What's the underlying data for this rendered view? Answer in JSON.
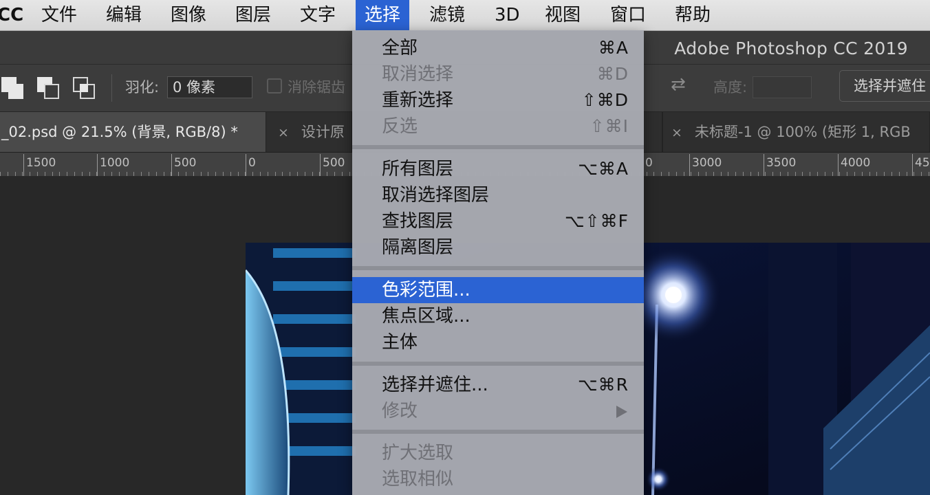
{
  "menubar": {
    "app": "CC",
    "items": [
      "文件",
      "编辑",
      "图像",
      "图层",
      "文字",
      "选择",
      "滤镜",
      "3D",
      "视图",
      "窗口",
      "帮助"
    ],
    "active": "选择"
  },
  "window": {
    "title": "Adobe Photoshop CC 2019"
  },
  "options": {
    "feather_label": "羽化:",
    "feather_value": "0 像素",
    "antialias_label": "消除锯齿",
    "height_label": "高度:",
    "refine_button": "选择并遮住"
  },
  "tabs": [
    {
      "label": "_02.psd @ 21.5% (背景, RGB/8) *",
      "active": true,
      "close": ""
    },
    {
      "label": "设计原",
      "active": false,
      "close": "×"
    },
    {
      "label": "未标题-1 @ 100% (矩形 1, RGB",
      "active": false,
      "close": "×"
    }
  ],
  "ruler": {
    "labels": [
      "1500",
      "1000",
      "500",
      "0",
      "500",
      "0",
      "3000",
      "3500",
      "4000",
      "45"
    ]
  },
  "select_menu": {
    "groups": [
      [
        {
          "label": "全部",
          "shortcut": "⌘A",
          "enabled": true
        },
        {
          "label": "取消选择",
          "shortcut": "⌘D",
          "enabled": false
        },
        {
          "label": "重新选择",
          "shortcut": "⇧⌘D",
          "enabled": true
        },
        {
          "label": "反选",
          "shortcut": "⇧⌘I",
          "enabled": false
        }
      ],
      [
        {
          "label": "所有图层",
          "shortcut": "⌥⌘A",
          "enabled": true
        },
        {
          "label": "取消选择图层",
          "shortcut": "",
          "enabled": true
        },
        {
          "label": "查找图层",
          "shortcut": "⌥⇧⌘F",
          "enabled": true
        },
        {
          "label": "隔离图层",
          "shortcut": "",
          "enabled": true
        }
      ],
      [
        {
          "label": "色彩范围...",
          "shortcut": "",
          "enabled": true,
          "highlighted": true
        },
        {
          "label": "焦点区域...",
          "shortcut": "",
          "enabled": true
        },
        {
          "label": "主体",
          "shortcut": "",
          "enabled": true
        }
      ],
      [
        {
          "label": "选择并遮住...",
          "shortcut": "⌥⌘R",
          "enabled": true
        },
        {
          "label": "修改",
          "shortcut": "",
          "enabled": false,
          "submenu": true
        }
      ],
      [
        {
          "label": "扩大选取",
          "shortcut": "",
          "enabled": false
        },
        {
          "label": "选取相似",
          "shortcut": "",
          "enabled": false
        }
      ]
    ]
  },
  "colors": {
    "menu_highlight": "#2b63d3",
    "app_bg": "#282828",
    "menu_bg": "#a8aab2"
  }
}
